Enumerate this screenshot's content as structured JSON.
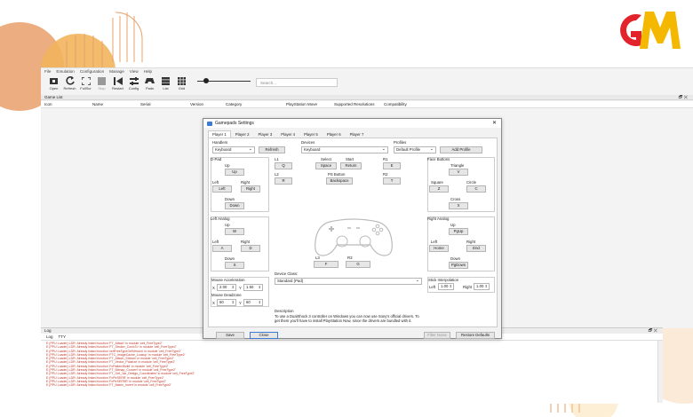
{
  "colors": {
    "deco_orange": "#e9a06a",
    "logo_red": "#e3232c",
    "logo_yellow": "#f5b800",
    "log_red": "#c0392b"
  },
  "menu": [
    "File",
    "Emulation",
    "Configuration",
    "Manage",
    "View",
    "Help"
  ],
  "toolbar": [
    {
      "label": "Open",
      "icon": "folder-open-icon"
    },
    {
      "label": "Refresh",
      "icon": "refresh-icon"
    },
    {
      "label": "FullScr",
      "icon": "fullscreen-icon"
    },
    {
      "label": "Stop",
      "icon": "stop-icon"
    },
    {
      "label": "Restart",
      "icon": "restart-icon"
    },
    {
      "label": "Config",
      "icon": "config-icon"
    },
    {
      "label": "Pads",
      "icon": "gamepad-icon"
    },
    {
      "label": "List",
      "icon": "list-icon"
    },
    {
      "label": "Grid",
      "icon": "grid-icon"
    }
  ],
  "search_placeholder": "Search...",
  "game_list_title": "Game List",
  "columns": [
    "Icon",
    "Name",
    "Serial",
    "Version",
    "Category",
    "PlayStation Move",
    "Supported Resolutions",
    "Compatibility"
  ],
  "log": {
    "title": "Log",
    "tabs": [
      "Log",
      "TTY"
    ],
    "lines": [
      "E {PPU Loader} LDR: Already linked function 'FT_Attach' in module 'cell_FreeType2'",
      "E {PPU Loader} LDR: Already linked function 'FT_Stroker_ConicTo' in module 'cell_FreeType2'",
      "E {PPU Loader} LDR: Already linked function 'cellFreeTypeGetVersion' in module 'cell_FreeType2'",
      "E {PPU Loader} LDR: Already linked function 'FTC_ImageCache_Lookup' in module 'cell_FreeType2'",
      "E {PPU Loader} LDR: Already linked function 'FT_Attach_Stream' in module 'cell_FreeType2'",
      "E {PPU Loader} LDR: Already linked function 'FT_Vector_Polarize' in module 'cell_FreeType2'",
      "E {PPU Loader} LDR: Already linked function 'FcPatternBuild' in module 'cell_FreeType2'",
      "E {PPU Loader} LDR: Already linked function 'FT_Bitmap_Convert' in module 'cell_FreeType2'",
      "E {PPU Loader} LDR: Already linked function 'FT_Get_Var_Design_Coordinates' in module 'cell_FreeType2'",
      "E {PPU Loader} LDR: Already linked function 'FcPtrSERR' in module 'cell_FreeType2'",
      "E {PPU Loader} LDR: Already linked function 'FcPtrSERSR' in module 'cell_FreeType2'",
      "E {PPU Loader} LDR: Already linked function 'FT_Matrix_Invert' in module 'cell_FreeType2'"
    ]
  },
  "dialog": {
    "title": "Gamepads Settings",
    "player_tabs": [
      "Player 1",
      "Player 2",
      "Player 3",
      "Player 4",
      "Player 5",
      "Player 6",
      "Player 7"
    ],
    "handlers": {
      "label": "Handlers",
      "value": "Keyboard"
    },
    "devices": {
      "label": "Devices",
      "value": "Keyboard"
    },
    "refresh": "Refresh",
    "profiles": {
      "label": "Profiles",
      "value": "Default Profile",
      "add": "Add Profile"
    },
    "dpad": {
      "label": "D-Pad",
      "up_l": "Up",
      "up": "Up",
      "left_l": "Left",
      "left": "Left",
      "right_l": "Right",
      "right": "Right",
      "down_l": "Down",
      "down": "Down"
    },
    "l1": {
      "label": "L1",
      "value": "Q"
    },
    "l2": {
      "label": "L2",
      "value": "R"
    },
    "select": {
      "label": "Select",
      "value": "Space"
    },
    "start": {
      "label": "Start",
      "value": "Return"
    },
    "ps": {
      "label": "PS Button",
      "value": "Backspace"
    },
    "r1": {
      "label": "R1",
      "value": "E"
    },
    "r2": {
      "label": "R2",
      "value": "T"
    },
    "face": {
      "label": "Face Buttons",
      "tri_l": "Triangle",
      "tri": "V",
      "sq_l": "Square",
      "sq": "Z",
      "circ_l": "Circle",
      "circ": "C",
      "cross_l": "Cross",
      "cross": "X"
    },
    "lanalog": {
      "label": "Left Analog",
      "up_l": "Up",
      "up": "W",
      "left_l": "Left",
      "left": "A",
      "right_l": "Right",
      "right": "D",
      "down_l": "Down",
      "down": "S"
    },
    "ranalog": {
      "label": "Right Analog",
      "up_l": "Up",
      "up": "PgUp",
      "left_l": "Left",
      "left": "Home",
      "right_l": "Right",
      "right": "End",
      "down_l": "Down",
      "down": "PgDown"
    },
    "l3": {
      "label": "L3",
      "value": "F"
    },
    "r3": {
      "label": "R3",
      "value": "G"
    },
    "device_class": {
      "label": "Device Class:",
      "value": "Standard (Pad)"
    },
    "mouse_accel": {
      "label": "Mouse Acceleration",
      "x_l": "X",
      "x": "2.00",
      "y_l": "Y",
      "y": "1.50"
    },
    "mouse_dead": {
      "label": "Mouse Deadzone",
      "x_l": "X",
      "x": "60",
      "y_l": "Y",
      "y": "60"
    },
    "stick": {
      "label": "Stick Interpolation",
      "left_l": "Left",
      "left": "1.00",
      "right_l": "Right",
      "right": "1.00"
    },
    "description": {
      "label": "Description",
      "text": "To use a DualShock 3 controller on Windows you can now use Sony's official drivers. To get them you'll have to install PlayStation Now, since the drivers are bundled with it."
    },
    "save": "Save",
    "close": "Close",
    "filter": "Filter Noise",
    "restore": "Restore Defaults"
  }
}
